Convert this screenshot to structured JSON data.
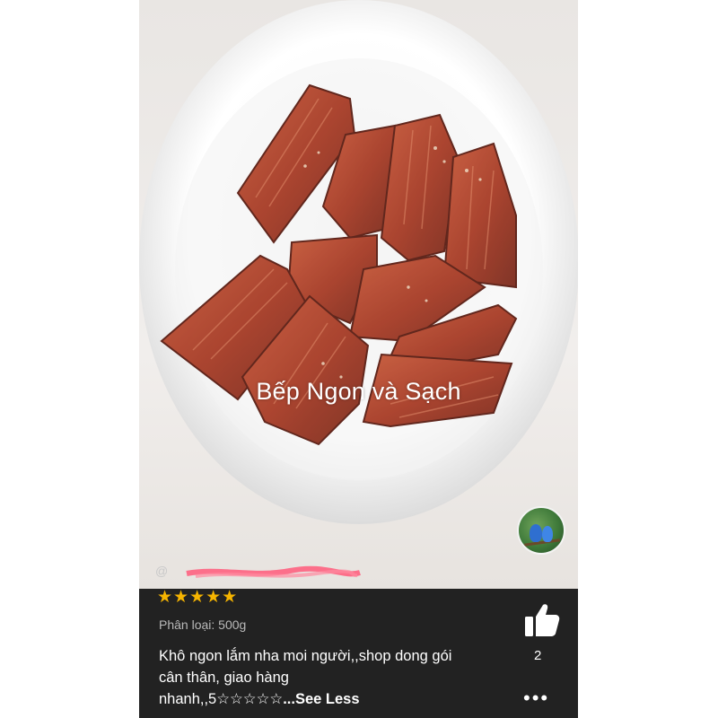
{
  "photo": {
    "watermark": "Bếp Ngon và Sạch"
  },
  "reviewer": {
    "username": "@"
  },
  "review": {
    "stars": "★★★★★",
    "variant_label": "Phân loại: 500g",
    "comment_text": "Khô ngon lắm nha moi người,,shop dong gói cân thân, giao hàng nhanh,,5☆☆☆☆☆",
    "toggle_label": "...See Less"
  },
  "actions": {
    "like_icon": "thumbs-up-icon",
    "like_count": "2",
    "more_icon": "more-dots-icon",
    "more_label": "•••"
  },
  "colors": {
    "panel_bg": "#222222",
    "star": "#f5b400"
  }
}
